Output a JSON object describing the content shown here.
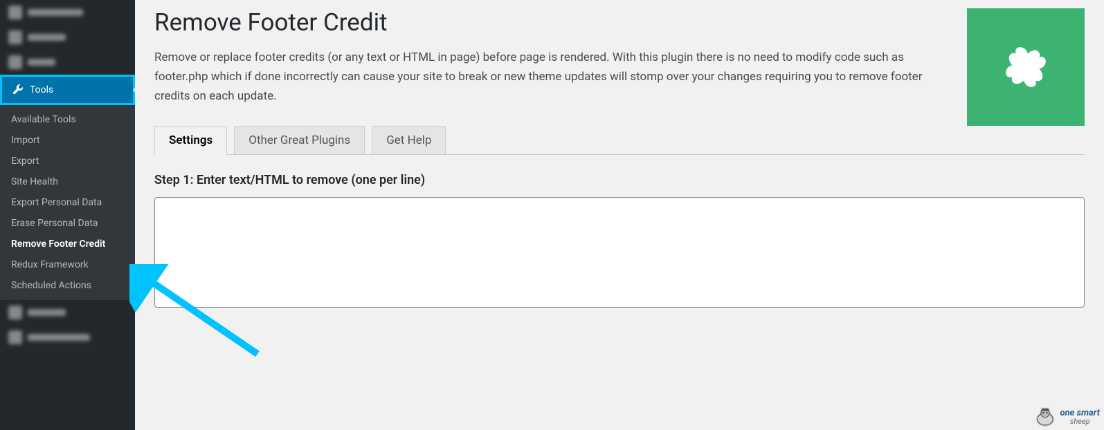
{
  "sidebar": {
    "tools_label": "Tools",
    "submenu": [
      "Available Tools",
      "Import",
      "Export",
      "Site Health",
      "Export Personal Data",
      "Erase Personal Data",
      "Remove Footer Credit",
      "Redux Framework",
      "Scheduled Actions"
    ],
    "active_submenu_index": 6
  },
  "page": {
    "title": "Remove Footer Credit",
    "description": "Remove or replace footer credits (or any text or HTML in page) before page is rendered. With this plugin there is no need to modify code such as footer.php which if done incorrectly can cause your site to break or new theme updates will stomp over your changes requiring you to remove footer credits on each update.",
    "tabs": [
      "Settings",
      "Other Great Plugins",
      "Get Help"
    ],
    "active_tab_index": 0,
    "step1_label": "Step 1: Enter text/HTML to remove (one per line)",
    "step1_value": ""
  },
  "watermark": {
    "brand_top": "one smart",
    "brand_bottom": "sheep"
  }
}
